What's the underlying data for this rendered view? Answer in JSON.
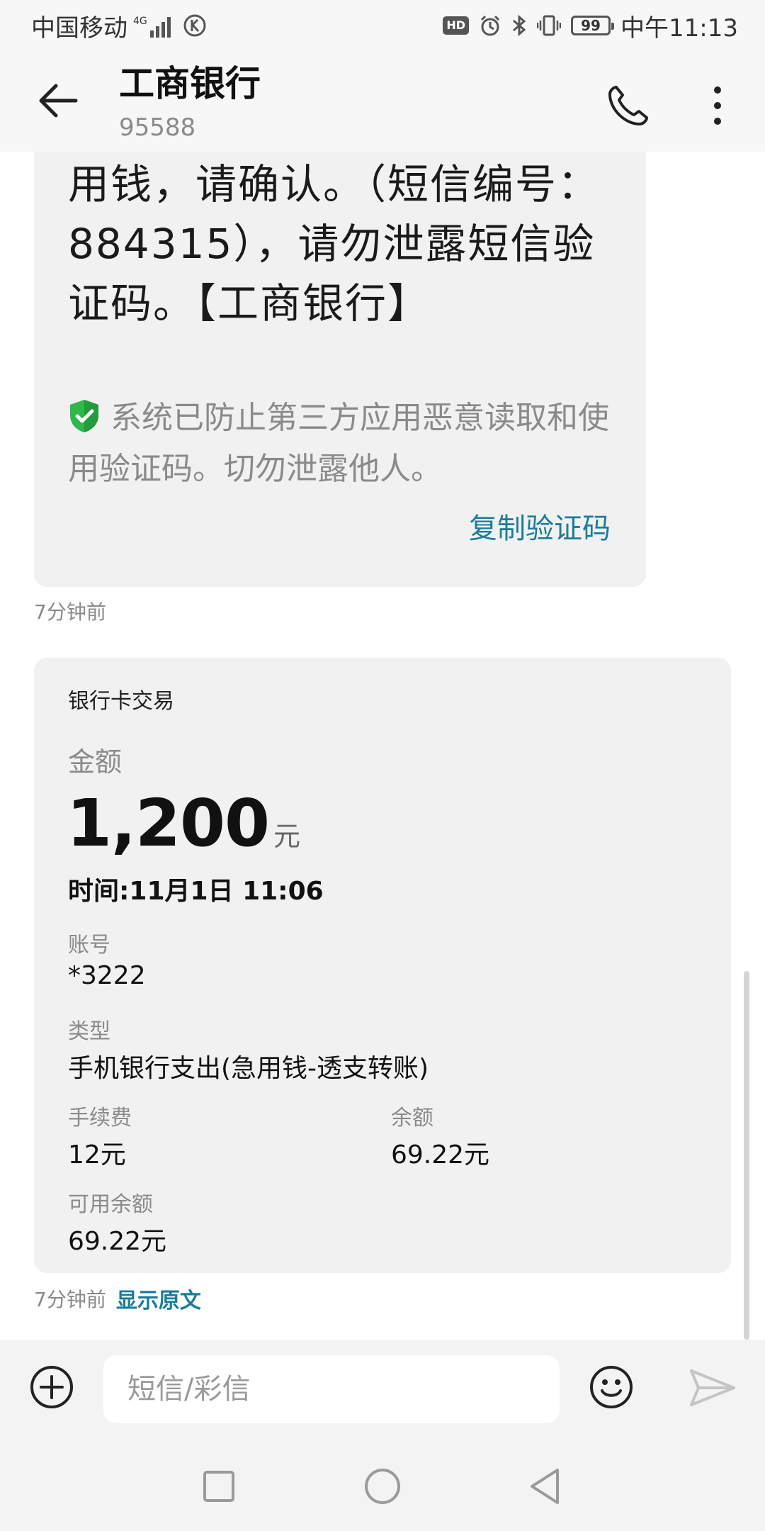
{
  "status_bar": {
    "carrier": "中国移动",
    "network": "4G",
    "hd_badge": "HD",
    "battery_level": "99",
    "time": "中午11:13"
  },
  "header": {
    "title": "工商银行",
    "number": "95588"
  },
  "messages": {
    "sms": {
      "text": "用钱，请确认。（短信编号：884315），请勿泄露短信验证码。【工商银行】",
      "security_note": "系统已防止第三方应用恶意读取和使用验证码。切勿泄露他人。",
      "copy_label": "复制验证码",
      "time_ago": "7分钟前"
    },
    "card": {
      "title": "银行卡交易",
      "amount_label": "金额",
      "amount": "1,200",
      "amount_unit": "元",
      "time_line": "时间:11月1日 11:06",
      "account_label": "账号",
      "account": "*3222",
      "type_label": "类型",
      "type": "手机银行支出(急用钱-透支转账)",
      "fee_label": "手续费",
      "fee": "12元",
      "balance_label": "余额",
      "balance": "69.22元",
      "available_label": "可用余额",
      "available": "69.22元",
      "time_ago": "7分钟前",
      "show_original": "显示原文"
    }
  },
  "input": {
    "placeholder": "短信/彩信"
  },
  "colors": {
    "accent": "#1a7d99",
    "shield_green": "#2eb84b",
    "bubble_bg": "#f1f1f1"
  },
  "icons": {
    "back": "arrow-left-icon",
    "call": "phone-icon",
    "more": "more-vertical-icon",
    "shield": "shield-check-icon",
    "add": "plus-circle-icon",
    "emoji": "smiley-icon",
    "send": "send-icon",
    "recent": "square-icon",
    "home": "circle-icon",
    "back_nav": "triangle-back-icon"
  }
}
